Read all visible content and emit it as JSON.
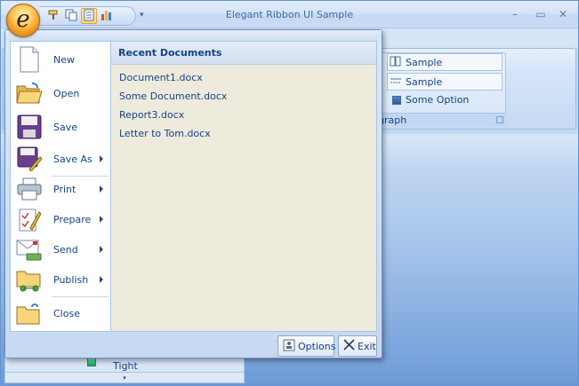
{
  "window": {
    "title": "Elegant Ribbon UI Sample",
    "controls": {
      "minimize": "–",
      "maximize": "▭",
      "close": "✕"
    }
  },
  "quick_access": {
    "icons": [
      "paintbrush-icon",
      "copy-icon",
      "document-icon",
      "chart-icon"
    ],
    "more": "▾"
  },
  "app_button": {
    "glyph": "e"
  },
  "app_menu": {
    "items": [
      {
        "label": "New",
        "icon": "new-document-icon",
        "submenu": false
      },
      {
        "label": "Open",
        "icon": "open-folder-icon",
        "submenu": false
      },
      {
        "label": "Save",
        "icon": "save-disk-icon",
        "submenu": false
      },
      {
        "label": "Save As",
        "icon": "save-as-icon",
        "submenu": true
      },
      {
        "label": "Print",
        "icon": "printer-icon",
        "submenu": true
      },
      {
        "label": "Prepare",
        "icon": "prepare-checklist-icon",
        "submenu": true
      },
      {
        "label": "Send",
        "icon": "send-mail-icon",
        "submenu": true
      },
      {
        "label": "Publish",
        "icon": "publish-folder-icon",
        "submenu": true
      },
      {
        "label": "Close",
        "icon": "close-folder-icon",
        "submenu": false
      }
    ],
    "recent": {
      "header": "Recent Documents",
      "documents": [
        "Document1.docx",
        "Some Document.docx",
        "Report3.docx",
        "Letter to Tom.docx"
      ]
    },
    "footer": {
      "options_label": "Options",
      "exit_label": "Exit"
    }
  },
  "ribbon_group": {
    "rows": [
      "Sample",
      "Sample"
    ],
    "option_label": "Some Option",
    "caption": "graph"
  },
  "left_panel": {
    "label": "Tight",
    "scroll": "▾"
  },
  "colors": {
    "accent": "#15428b",
    "frame": "#6593cf",
    "recent_bg": "#eeebdc",
    "orb": "#f2a126"
  }
}
